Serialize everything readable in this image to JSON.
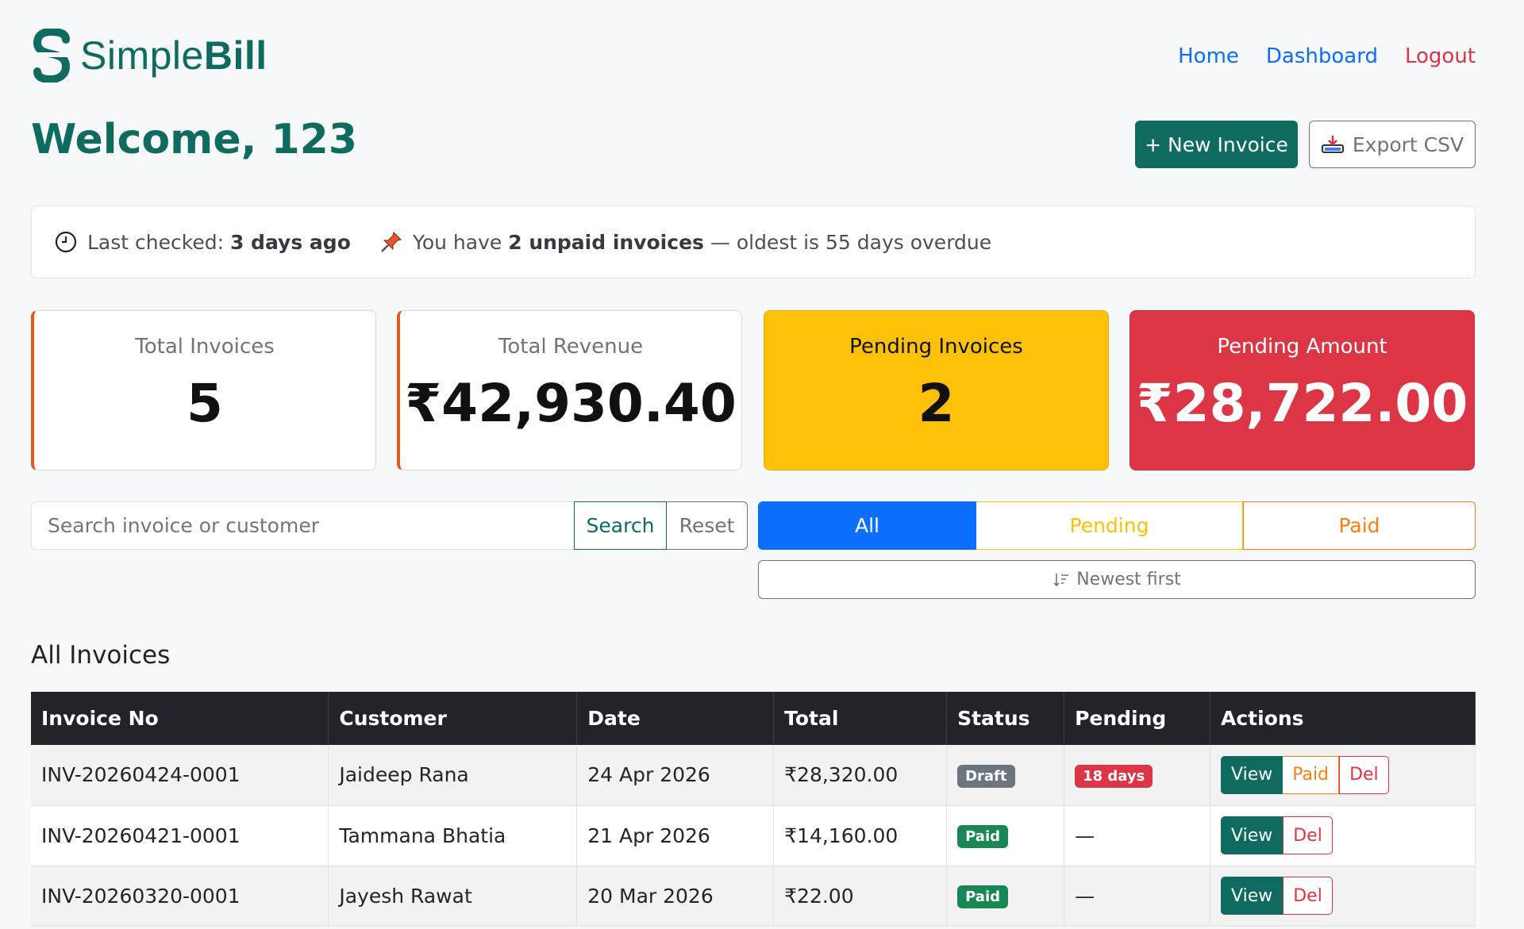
{
  "brand": {
    "name_light": "Simple",
    "name_bold": "Bill"
  },
  "nav": {
    "home": "Home",
    "dashboard": "Dashboard",
    "logout": "Logout"
  },
  "welcome": "Welcome, 123",
  "actions": {
    "new_invoice": "+ New Invoice",
    "export_csv": "Export CSV"
  },
  "notice": {
    "last_checked_label": "Last checked:",
    "last_checked_value": "3 days ago",
    "unpaid_prefix": "You have",
    "unpaid_count": "2 unpaid invoices",
    "unpaid_suffix": "— oldest is 55 days overdue"
  },
  "stats": [
    {
      "label": "Total Invoices",
      "value": "5"
    },
    {
      "label": "Total Revenue",
      "value": "₹42,930.40"
    },
    {
      "label": "Pending Invoices",
      "value": "2"
    },
    {
      "label": "Pending Amount",
      "value": "₹28,722.00"
    }
  ],
  "search": {
    "placeholder": "Search invoice or customer",
    "search_label": "Search",
    "reset_label": "Reset"
  },
  "filters": {
    "all": "All",
    "pending": "Pending",
    "paid": "Paid"
  },
  "sort_label": "Newest first",
  "section_title": "All Invoices",
  "table": {
    "headers": [
      "Invoice No",
      "Customer",
      "Date",
      "Total",
      "Status",
      "Pending",
      "Actions"
    ],
    "rows": [
      {
        "invoice_no": "INV-20260424-0001",
        "customer": "Jaideep Rana",
        "date": "24 Apr 2026",
        "total": "₹28,320.00",
        "status": "Draft",
        "pending": "18 days",
        "actions": [
          "View",
          "Paid",
          "Del"
        ]
      },
      {
        "invoice_no": "INV-20260421-0001",
        "customer": "Tammana Bhatia",
        "date": "21 Apr 2026",
        "total": "₹14,160.00",
        "status": "Paid",
        "pending": "—",
        "actions": [
          "View",
          "Del"
        ]
      },
      {
        "invoice_no": "INV-20260320-0001",
        "customer": "Jayesh Rawat",
        "date": "20 Mar 2026",
        "total": "₹22.00",
        "status": "Paid",
        "pending": "—",
        "actions": [
          "View",
          "Del"
        ]
      }
    ]
  },
  "colors": {
    "brand": "#0f6b5f",
    "primary": "#0d6efd",
    "warning": "#ffc107",
    "danger": "#dc3545",
    "success": "#198754"
  }
}
